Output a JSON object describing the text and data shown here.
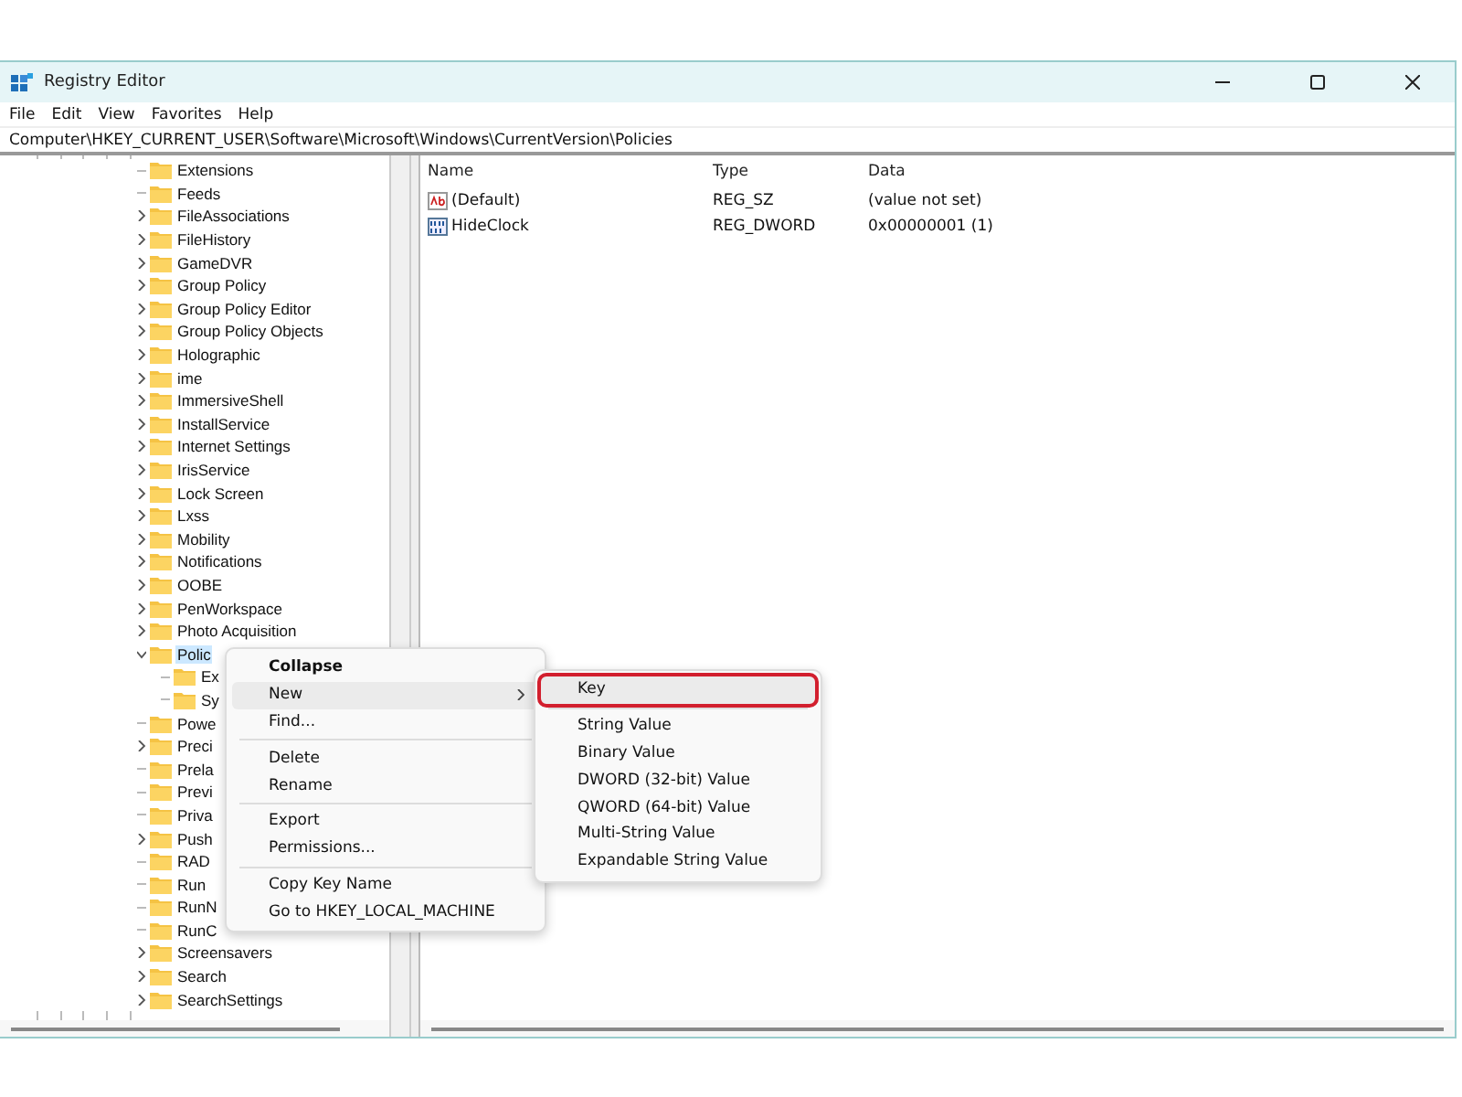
{
  "window": {
    "title": "Registry Editor"
  },
  "menu_bar": [
    "File",
    "Edit",
    "View",
    "Favorites",
    "Help"
  ],
  "address": "Computer\\HKEY_CURRENT_USER\\Software\\Microsoft\\Windows\\CurrentVersion\\Policies",
  "tree": [
    {
      "label": "Extensions",
      "expandable": false,
      "expanded": false,
      "selected": false
    },
    {
      "label": "Feeds",
      "expandable": false,
      "expanded": false,
      "selected": false
    },
    {
      "label": "FileAssociations",
      "expandable": true,
      "expanded": false,
      "selected": false
    },
    {
      "label": "FileHistory",
      "expandable": true,
      "expanded": false,
      "selected": false
    },
    {
      "label": "GameDVR",
      "expandable": true,
      "expanded": false,
      "selected": false
    },
    {
      "label": "Group Policy",
      "expandable": true,
      "expanded": false,
      "selected": false
    },
    {
      "label": "Group Policy Editor",
      "expandable": true,
      "expanded": false,
      "selected": false
    },
    {
      "label": "Group Policy Objects",
      "expandable": true,
      "expanded": false,
      "selected": false
    },
    {
      "label": "Holographic",
      "expandable": true,
      "expanded": false,
      "selected": false
    },
    {
      "label": "ime",
      "expandable": true,
      "expanded": false,
      "selected": false
    },
    {
      "label": "ImmersiveShell",
      "expandable": true,
      "expanded": false,
      "selected": false
    },
    {
      "label": "InstallService",
      "expandable": true,
      "expanded": false,
      "selected": false
    },
    {
      "label": "Internet Settings",
      "expandable": true,
      "expanded": false,
      "selected": false
    },
    {
      "label": "IrisService",
      "expandable": true,
      "expanded": false,
      "selected": false
    },
    {
      "label": "Lock Screen",
      "expandable": true,
      "expanded": false,
      "selected": false
    },
    {
      "label": "Lxss",
      "expandable": true,
      "expanded": false,
      "selected": false
    },
    {
      "label": "Mobility",
      "expandable": true,
      "expanded": false,
      "selected": false
    },
    {
      "label": "Notifications",
      "expandable": true,
      "expanded": false,
      "selected": false
    },
    {
      "label": "OOBE",
      "expandable": true,
      "expanded": false,
      "selected": false
    },
    {
      "label": "PenWorkspace",
      "expandable": true,
      "expanded": false,
      "selected": false
    },
    {
      "label": "Photo Acquisition",
      "expandable": true,
      "expanded": false,
      "selected": false
    },
    {
      "label": "Polic",
      "expandable": true,
      "expanded": true,
      "selected": true,
      "children": [
        {
          "label": "Ex",
          "expandable": false,
          "expanded": false,
          "selected": false
        },
        {
          "label": "Sy",
          "expandable": false,
          "expanded": false,
          "selected": false
        }
      ]
    },
    {
      "label": "Powe",
      "expandable": false,
      "expanded": false,
      "selected": false
    },
    {
      "label": "Preci",
      "expandable": true,
      "expanded": false,
      "selected": false
    },
    {
      "label": "Prela",
      "expandable": false,
      "expanded": false,
      "selected": false
    },
    {
      "label": "Previ",
      "expandable": false,
      "expanded": false,
      "selected": false
    },
    {
      "label": "Priva",
      "expandable": false,
      "expanded": false,
      "selected": false
    },
    {
      "label": "Push",
      "expandable": true,
      "expanded": false,
      "selected": false
    },
    {
      "label": "RAD",
      "expandable": false,
      "expanded": false,
      "selected": false
    },
    {
      "label": "Run",
      "expandable": false,
      "expanded": false,
      "selected": false
    },
    {
      "label": "RunN",
      "expandable": false,
      "expanded": false,
      "selected": false
    },
    {
      "label": "RunC",
      "expandable": false,
      "expanded": false,
      "selected": false
    },
    {
      "label": "Screensavers",
      "expandable": true,
      "expanded": false,
      "selected": false
    },
    {
      "label": "Search",
      "expandable": true,
      "expanded": false,
      "selected": false
    },
    {
      "label": "SearchSettings",
      "expandable": true,
      "expanded": false,
      "selected": false
    }
  ],
  "values": {
    "columns": [
      "Name",
      "Type",
      "Data"
    ],
    "rows": [
      {
        "kind": "string",
        "name": "(Default)",
        "type": "REG_SZ",
        "data": "(value not set)"
      },
      {
        "kind": "binary",
        "name": "HideClock",
        "type": "REG_DWORD",
        "data": "0x00000001 (1)"
      }
    ]
  },
  "context_menu": [
    {
      "kind": "item",
      "label": "Collapse",
      "bold": true,
      "hovered": false,
      "submenu": false
    },
    {
      "kind": "item",
      "label": "New",
      "bold": false,
      "hovered": true,
      "submenu": true
    },
    {
      "kind": "item",
      "label": "Find...",
      "bold": false,
      "hovered": false,
      "submenu": false
    },
    {
      "kind": "separator"
    },
    {
      "kind": "item",
      "label": "Delete",
      "bold": false,
      "hovered": false,
      "submenu": false
    },
    {
      "kind": "item",
      "label": "Rename",
      "bold": false,
      "hovered": false,
      "submenu": false
    },
    {
      "kind": "separator"
    },
    {
      "kind": "item",
      "label": "Export",
      "bold": false,
      "hovered": false,
      "submenu": false
    },
    {
      "kind": "item",
      "label": "Permissions...",
      "bold": false,
      "hovered": false,
      "submenu": false
    },
    {
      "kind": "separator"
    },
    {
      "kind": "item",
      "label": "Copy Key Name",
      "bold": false,
      "hovered": false,
      "submenu": false
    },
    {
      "kind": "item",
      "label": "Go to HKEY_LOCAL_MACHINE",
      "bold": false,
      "hovered": false,
      "submenu": false
    }
  ],
  "submenu": [
    {
      "kind": "item",
      "label": "Key",
      "highlighted": true
    },
    {
      "kind": "separator"
    },
    {
      "kind": "item",
      "label": "String Value",
      "highlighted": false
    },
    {
      "kind": "item",
      "label": "Binary Value",
      "highlighted": false
    },
    {
      "kind": "item",
      "label": "DWORD (32-bit) Value",
      "highlighted": false
    },
    {
      "kind": "item",
      "label": "QWORD (64-bit) Value",
      "highlighted": false
    },
    {
      "kind": "item",
      "label": "Multi-String Value",
      "highlighted": false
    },
    {
      "kind": "item",
      "label": "Expandable String Value",
      "highlighted": false
    }
  ]
}
